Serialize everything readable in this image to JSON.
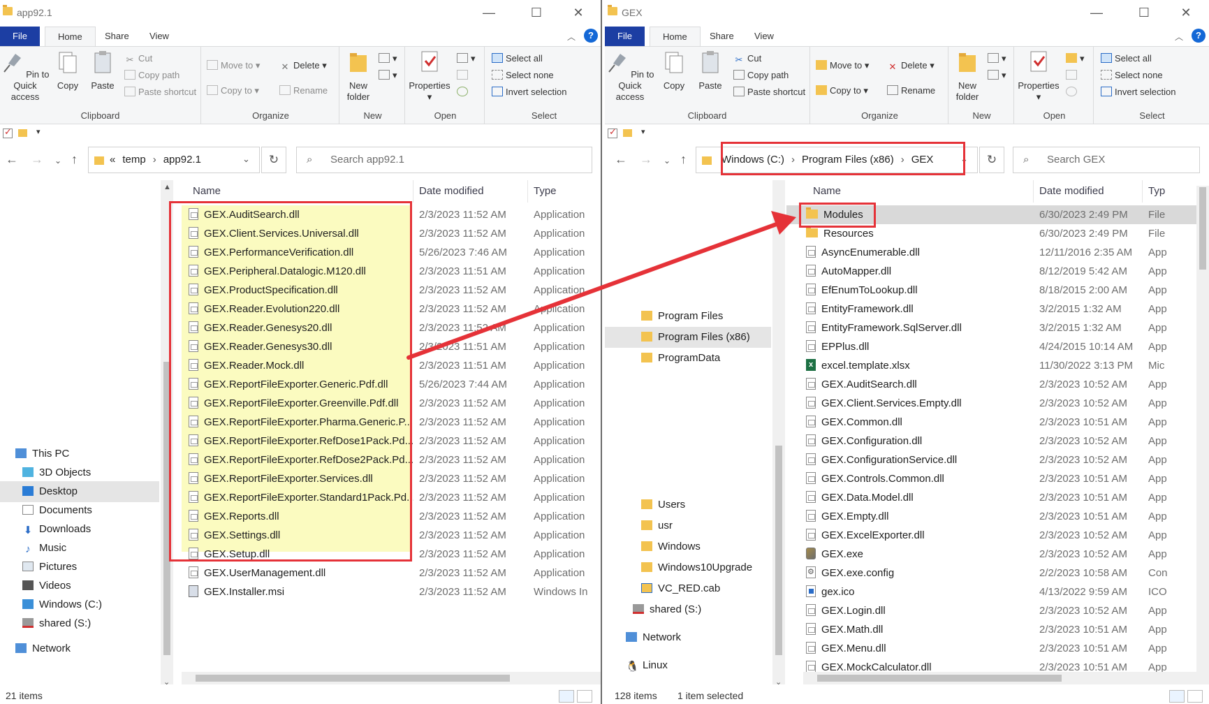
{
  "left": {
    "title": "app92.1",
    "tabs": [
      "File",
      "Home",
      "Share",
      "View"
    ],
    "ribbon": {
      "pin": "Pin to Quick access",
      "copy": "Copy",
      "paste": "Paste",
      "cut": "Cut",
      "copy_path": "Copy path",
      "paste_shortcut": "Paste shortcut",
      "clipboard": "Clipboard",
      "move_to": "Move to",
      "copy_to": "Copy to",
      "delete": "Delete",
      "rename": "Rename",
      "organize": "Organize",
      "new_folder": "New folder",
      "new": "New",
      "properties": "Properties",
      "open": "Open",
      "select_all": "Select all",
      "select_none": "Select none",
      "invert_selection": "Invert selection",
      "select": "Select"
    },
    "breadcrumb": [
      "«",
      "temp",
      "app92.1"
    ],
    "search_placeholder": "Search app92.1",
    "columns": [
      "Name",
      "Date modified",
      "Type"
    ],
    "nav": [
      "This PC",
      "3D Objects",
      "Desktop",
      "Documents",
      "Downloads",
      "Music",
      "Pictures",
      "Videos",
      "Windows (C:)",
      "shared (S:)",
      "Network"
    ],
    "files": [
      {
        "name": "GEX.AuditSearch.dll",
        "date": "2/3/2023 11:52 AM",
        "type": "Application"
      },
      {
        "name": "GEX.Client.Services.Universal.dll",
        "date": "2/3/2023 11:52 AM",
        "type": "Application"
      },
      {
        "name": "GEX.PerformanceVerification.dll",
        "date": "5/26/2023 7:46 AM",
        "type": "Application"
      },
      {
        "name": "GEX.Peripheral.Datalogic.M120.dll",
        "date": "2/3/2023 11:51 AM",
        "type": "Application"
      },
      {
        "name": "GEX.ProductSpecification.dll",
        "date": "2/3/2023 11:52 AM",
        "type": "Application"
      },
      {
        "name": "GEX.Reader.Evolution220.dll",
        "date": "2/3/2023 11:52 AM",
        "type": "Application"
      },
      {
        "name": "GEX.Reader.Genesys20.dll",
        "date": "2/3/2023 11:52 AM",
        "type": "Application"
      },
      {
        "name": "GEX.Reader.Genesys30.dll",
        "date": "2/3/2023 11:51 AM",
        "type": "Application"
      },
      {
        "name": "GEX.Reader.Mock.dll",
        "date": "2/3/2023 11:51 AM",
        "type": "Application"
      },
      {
        "name": "GEX.ReportFileExporter.Generic.Pdf.dll",
        "date": "5/26/2023 7:44 AM",
        "type": "Application"
      },
      {
        "name": "GEX.ReportFileExporter.Greenville.Pdf.dll",
        "date": "2/3/2023 11:52 AM",
        "type": "Application"
      },
      {
        "name": "GEX.ReportFileExporter.Pharma.Generic.P...",
        "date": "2/3/2023 11:52 AM",
        "type": "Application"
      },
      {
        "name": "GEX.ReportFileExporter.RefDose1Pack.Pd...",
        "date": "2/3/2023 11:52 AM",
        "type": "Application"
      },
      {
        "name": "GEX.ReportFileExporter.RefDose2Pack.Pd...",
        "date": "2/3/2023 11:52 AM",
        "type": "Application"
      },
      {
        "name": "GEX.ReportFileExporter.Services.dll",
        "date": "2/3/2023 11:52 AM",
        "type": "Application"
      },
      {
        "name": "GEX.ReportFileExporter.Standard1Pack.Pd...",
        "date": "2/3/2023 11:52 AM",
        "type": "Application"
      },
      {
        "name": "GEX.Reports.dll",
        "date": "2/3/2023 11:52 AM",
        "type": "Application"
      },
      {
        "name": "GEX.Settings.dll",
        "date": "2/3/2023 11:52 AM",
        "type": "Application"
      },
      {
        "name": "GEX.Setup.dll",
        "date": "2/3/2023 11:52 AM",
        "type": "Application"
      },
      {
        "name": "GEX.UserManagement.dll",
        "date": "2/3/2023 11:52 AM",
        "type": "Application"
      },
      {
        "name": "GEX.Installer.msi",
        "date": "2/3/2023 11:52 AM",
        "type": "Windows In"
      }
    ],
    "status": "21 items"
  },
  "right": {
    "title": "GEX",
    "tabs": [
      "File",
      "Home",
      "Share",
      "View"
    ],
    "ribbon": {
      "pin": "Pin to Quick access",
      "copy": "Copy",
      "paste": "Paste",
      "cut": "Cut",
      "copy_path": "Copy path",
      "paste_shortcut": "Paste shortcut",
      "clipboard": "Clipboard",
      "move_to": "Move to",
      "copy_to": "Copy to",
      "delete": "Delete",
      "rename": "Rename",
      "organize": "Organize",
      "new_folder": "New folder",
      "new": "New",
      "properties": "Properties",
      "open": "Open",
      "select_all": "Select all",
      "select_none": "Select none",
      "invert_selection": "Invert selection",
      "select": "Select"
    },
    "breadcrumb": [
      "Windows (C:)",
      "Program Files (x86)",
      "GEX"
    ],
    "search_placeholder": "Search GEX",
    "columns": [
      "Name",
      "Date modified",
      "Typ"
    ],
    "nav": [
      "Program Files",
      "Program Files (x86)",
      "ProgramData",
      "Users",
      "usr",
      "Windows",
      "Windows10Upgrade",
      "VC_RED.cab",
      "shared (S:)",
      "Network",
      "Linux"
    ],
    "files": [
      {
        "name": "Modules",
        "date": "6/30/2023 2:49 PM",
        "type": "File",
        "kind": "folder"
      },
      {
        "name": "Resources",
        "date": "6/30/2023 2:49 PM",
        "type": "File",
        "kind": "folder"
      },
      {
        "name": "AsyncEnumerable.dll",
        "date": "12/11/2016 2:35 AM",
        "type": "App",
        "kind": "dll"
      },
      {
        "name": "AutoMapper.dll",
        "date": "8/12/2019 5:42 AM",
        "type": "App",
        "kind": "dll"
      },
      {
        "name": "EfEnumToLookup.dll",
        "date": "8/18/2015 2:00 AM",
        "type": "App",
        "kind": "dll"
      },
      {
        "name": "EntityFramework.dll",
        "date": "3/2/2015 1:32 AM",
        "type": "App",
        "kind": "dll"
      },
      {
        "name": "EntityFramework.SqlServer.dll",
        "date": "3/2/2015 1:32 AM",
        "type": "App",
        "kind": "dll"
      },
      {
        "name": "EPPlus.dll",
        "date": "4/24/2015 10:14 AM",
        "type": "App",
        "kind": "dll"
      },
      {
        "name": "excel.template.xlsx",
        "date": "11/30/2022 3:13 PM",
        "type": "Mic",
        "kind": "xlsx"
      },
      {
        "name": "GEX.AuditSearch.dll",
        "date": "2/3/2023 10:52 AM",
        "type": "App",
        "kind": "dll"
      },
      {
        "name": "GEX.Client.Services.Empty.dll",
        "date": "2/3/2023 10:52 AM",
        "type": "App",
        "kind": "dll"
      },
      {
        "name": "GEX.Common.dll",
        "date": "2/3/2023 10:51 AM",
        "type": "App",
        "kind": "dll"
      },
      {
        "name": "GEX.Configuration.dll",
        "date": "2/3/2023 10:52 AM",
        "type": "App",
        "kind": "dll"
      },
      {
        "name": "GEX.ConfigurationService.dll",
        "date": "2/3/2023 10:52 AM",
        "type": "App",
        "kind": "dll"
      },
      {
        "name": "GEX.Controls.Common.dll",
        "date": "2/3/2023 10:51 AM",
        "type": "App",
        "kind": "dll"
      },
      {
        "name": "GEX.Data.Model.dll",
        "date": "2/3/2023 10:51 AM",
        "type": "App",
        "kind": "dll"
      },
      {
        "name": "GEX.Empty.dll",
        "date": "2/3/2023 10:51 AM",
        "type": "App",
        "kind": "dll"
      },
      {
        "name": "GEX.ExcelExporter.dll",
        "date": "2/3/2023 10:52 AM",
        "type": "App",
        "kind": "dll"
      },
      {
        "name": "GEX.exe",
        "date": "2/3/2023 10:52 AM",
        "type": "App",
        "kind": "exe"
      },
      {
        "name": "GEX.exe.config",
        "date": "2/2/2023 10:58 AM",
        "type": "Con",
        "kind": "config"
      },
      {
        "name": "gex.ico",
        "date": "4/13/2022 9:59 AM",
        "type": "ICO",
        "kind": "ico"
      },
      {
        "name": "GEX.Login.dll",
        "date": "2/3/2023 10:52 AM",
        "type": "App",
        "kind": "dll"
      },
      {
        "name": "GEX.Math.dll",
        "date": "2/3/2023 10:51 AM",
        "type": "App",
        "kind": "dll"
      },
      {
        "name": "GEX.Menu.dll",
        "date": "2/3/2023 10:51 AM",
        "type": "App",
        "kind": "dll"
      },
      {
        "name": "GEX.MockCalculator.dll",
        "date": "2/3/2023 10:51 AM",
        "type": "App",
        "kind": "dll"
      }
    ],
    "status_count": "128 items",
    "status_selected": "1 item selected"
  },
  "colors": {
    "highlight": "#fbfbc0",
    "annotation_red": "#e53238",
    "file_tab": "#1c3ea3"
  }
}
